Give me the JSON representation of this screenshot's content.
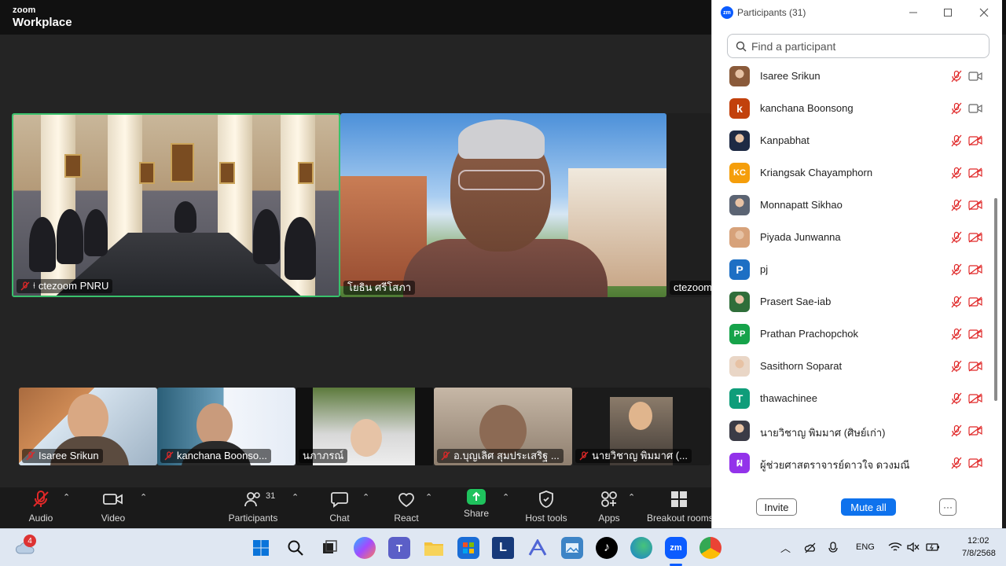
{
  "app": {
    "brand_line1": "zoom",
    "brand_line2": "Workplace"
  },
  "gallery": {
    "main_tiles": [
      {
        "name": "ctezoom PNRU"
      },
      {
        "name": "โยธิน ศรีโสภา"
      },
      {
        "name": "ctezoom"
      }
    ],
    "thumbnails": [
      {
        "name": "Isaree Srikun"
      },
      {
        "name": "kanchana Boonso..."
      },
      {
        "name": "นภาภรณ์"
      },
      {
        "name": "อ.บุญเลิศ สุมประเสริฐ ..."
      },
      {
        "name": "นายวิชาญ พิมมาศ (..."
      }
    ]
  },
  "controls": {
    "audio": "Audio",
    "video": "Video",
    "participants": "Participants",
    "participants_count": "31",
    "chat": "Chat",
    "react": "React",
    "share": "Share",
    "host_tools": "Host tools",
    "apps": "Apps",
    "breakout": "Breakout rooms"
  },
  "panel": {
    "badge": "zm",
    "title": "Participants (31)",
    "search_placeholder": "Find a participant",
    "participants": [
      {
        "name": "Isaree Srikun",
        "avatar_type": "photo",
        "avatar_color": "#8a5a3a",
        "mic": "muted",
        "video": "on"
      },
      {
        "name": "kanchana Boonsong",
        "avatar_type": "letter",
        "avatar_text": "k",
        "avatar_color": "#c2410c",
        "mic": "muted",
        "video": "on"
      },
      {
        "name": "Kanpabhat",
        "avatar_type": "photo",
        "avatar_color": "#1e2a44",
        "mic": "muted",
        "video": "off"
      },
      {
        "name": "Kriangsak Chayamphorn",
        "avatar_type": "letter",
        "avatar_text": "KC",
        "avatar_color": "#f59e0b",
        "mic": "muted",
        "video": "off"
      },
      {
        "name": "Monnapatt Sikhao",
        "avatar_type": "photo",
        "avatar_color": "#5b6473",
        "mic": "muted",
        "video": "off"
      },
      {
        "name": "Piyada Junwanna",
        "avatar_type": "photo",
        "avatar_color": "#d7a27a",
        "mic": "muted",
        "video": "off"
      },
      {
        "name": "pj",
        "avatar_type": "letter",
        "avatar_text": "P",
        "avatar_color": "#1d6fc4",
        "mic": "muted",
        "video": "off"
      },
      {
        "name": "Prasert Sae-iab",
        "avatar_type": "photo",
        "avatar_color": "#2f6e3a",
        "mic": "muted",
        "video": "off"
      },
      {
        "name": "Prathan Prachopchok",
        "avatar_type": "letter",
        "avatar_text": "PP",
        "avatar_color": "#16a34a",
        "mic": "muted",
        "video": "off"
      },
      {
        "name": "Sasithorn Soparat",
        "avatar_type": "photo",
        "avatar_color": "#e9d6c6",
        "mic": "muted",
        "video": "off"
      },
      {
        "name": "thawachinee",
        "avatar_type": "letter",
        "avatar_text": "T",
        "avatar_color": "#0f9d7a",
        "mic": "muted",
        "video": "off"
      },
      {
        "name": "นายวิชาญ พิมมาศ (ศิษย์เก่า)",
        "avatar_type": "photo",
        "avatar_color": "#3b3b46",
        "mic": "muted",
        "video": "off"
      },
      {
        "name": "ผู้ช่วยศาสตราจารย์ดาวใจ  ดวงมณี",
        "avatar_type": "letter",
        "avatar_text": "ผ",
        "avatar_color": "#9333ea",
        "mic": "muted",
        "video": "off"
      }
    ],
    "invite": "Invite",
    "mute_all": "Mute all",
    "more": "···"
  },
  "taskbar": {
    "weather_badge": "4",
    "lang": "ENG",
    "time": "12:02",
    "date": "7/8/2568"
  },
  "colors": {
    "zoom_blue": "#0b5cff",
    "active_speaker": "#39c16c",
    "muted_red": "#e02828",
    "share_green": "#1fc25d"
  }
}
